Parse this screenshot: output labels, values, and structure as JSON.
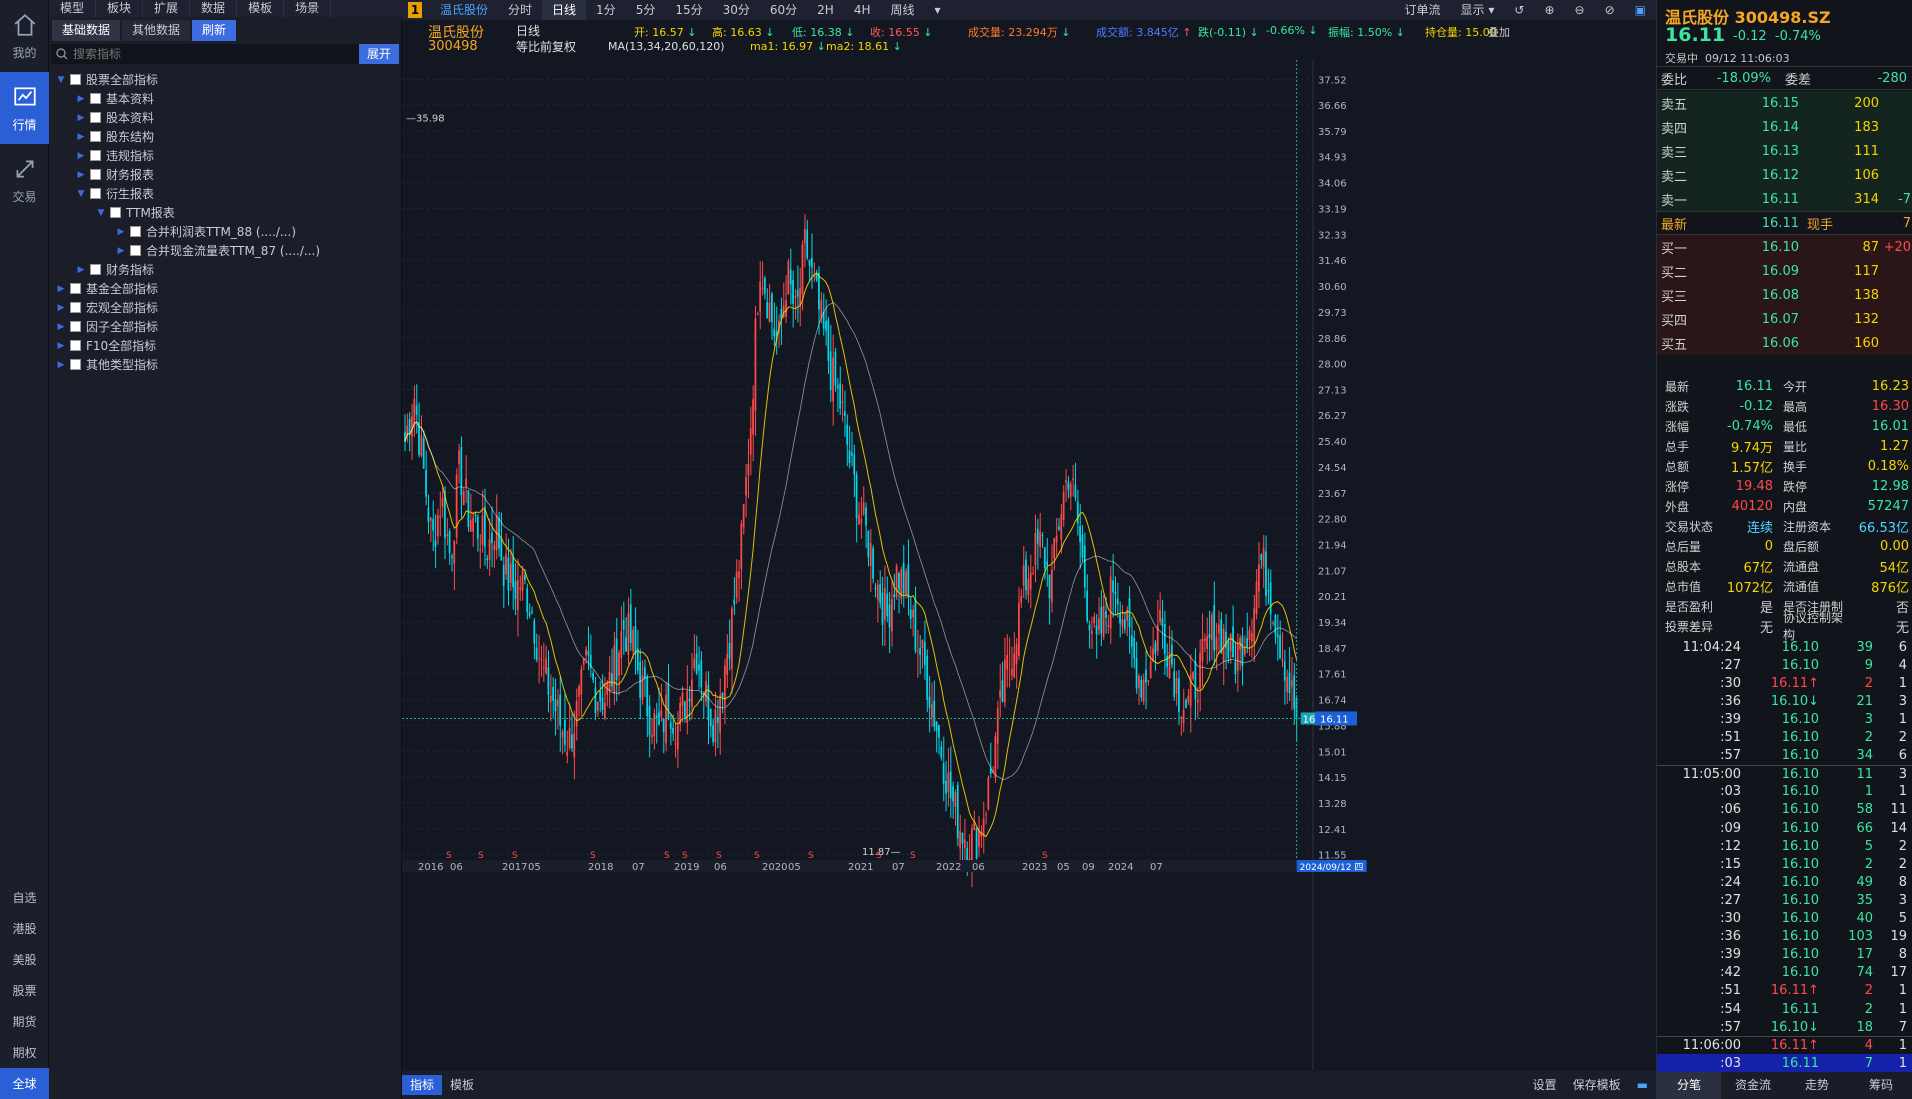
{
  "nav": {
    "items": [
      {
        "id": "home",
        "label": "我的"
      },
      {
        "id": "market",
        "label": "行情"
      },
      {
        "id": "trade",
        "label": "交易"
      }
    ],
    "markets": [
      "自选",
      "港股",
      "美股",
      "股票",
      "期货",
      "期权",
      "全球"
    ]
  },
  "menu": [
    "模型",
    "板块",
    "扩展",
    "数据",
    "模板",
    "场景"
  ],
  "panel": {
    "tabs": [
      "基础数据",
      "其他数据",
      "刷新"
    ],
    "search_placeholder": "搜索指标",
    "expand": "展开",
    "tree": [
      {
        "label": "股票全部指标",
        "lvl": 0,
        "open": true
      },
      {
        "label": "基本资料",
        "lvl": 1
      },
      {
        "label": "股本资料",
        "lvl": 1
      },
      {
        "label": "股东结构",
        "lvl": 1
      },
      {
        "label": "违规指标",
        "lvl": 1
      },
      {
        "label": "财务报表",
        "lvl": 1
      },
      {
        "label": "衍生报表",
        "lvl": 1,
        "open": true
      },
      {
        "label": "TTM报表",
        "lvl": 2,
        "open": true
      },
      {
        "label": "合并利润表TTM_88 (..../...)",
        "lvl": 3
      },
      {
        "label": "合并现金流量表TTM_87 (..../...)",
        "lvl": 3
      },
      {
        "label": "财务指标",
        "lvl": 1
      },
      {
        "label": "基金全部指标",
        "lvl": 0
      },
      {
        "label": "宏观全部指标",
        "lvl": 0
      },
      {
        "label": "因子全部指标",
        "lvl": 0
      },
      {
        "label": "F10全部指标",
        "lvl": 0
      },
      {
        "label": "其他类型指标",
        "lvl": 0
      }
    ]
  },
  "toolbar": {
    "badge": "1",
    "stock": "温氏股份",
    "periods": [
      "分时",
      "日线",
      "1分",
      "5分",
      "15分",
      "30分",
      "60分",
      "2H",
      "4H",
      "周线"
    ],
    "active": "日线",
    "right": [
      "订单流",
      "显示"
    ]
  },
  "info": {
    "name": "温氏股份",
    "code": "300498",
    "type": "日线",
    "fq": "等比前复权",
    "open_label": "开:",
    "open": "16.57",
    "high_label": "高:",
    "high": "16.63",
    "low_label": "低:",
    "low": "16.38",
    "close_label": "收:",
    "close": "16.55",
    "vol_label": "成交量:",
    "vol": "23.294万",
    "amt_label": "成交额:",
    "amt": "3.845亿",
    "fall": "跌(-0.11)",
    "fallpct": "-0.66%",
    "amp_label": "振幅:",
    "amp": "1.50%",
    "hold_label": "持仓量:",
    "hold": "15.00",
    "overlay": "叠加",
    "ma_text": "MA(13,34,20,60,120)",
    "ma1_label": "ma1:",
    "ma1": "16.97",
    "ma2_label": "ma2:",
    "ma2": "18.61"
  },
  "chart_data": {
    "type": "candlestick",
    "title": "温氏股份 300498 日线 等比前复权",
    "yticks": [
      37.52,
      36.66,
      35.79,
      34.93,
      34.06,
      33.19,
      32.33,
      31.46,
      30.6,
      29.73,
      28.86,
      28.0,
      27.13,
      26.27,
      25.4,
      24.54,
      23.67,
      22.8,
      21.94,
      21.07,
      20.21,
      19.34,
      18.47,
      17.61,
      16.74,
      15.88,
      15.01,
      14.15,
      13.28,
      12.41,
      11.55
    ],
    "ylim": [
      11.1,
      37.9
    ],
    "xlabels": [
      "2016",
      "06",
      "2017",
      "05",
      "2018",
      "07",
      "2019",
      "06",
      "2020",
      "05",
      "2021",
      "07",
      "2022",
      "06",
      "2023",
      "05",
      "09",
      "2024",
      "07"
    ],
    "cursor_date": "2024/09/12 四",
    "last_price": "16.11",
    "max_label": "35.98",
    "min_label": "11.87",
    "cursor_price": "16.11",
    "close_series": [
      25.4,
      27.0,
      24.5,
      22.0,
      23.5,
      21.5,
      24.5,
      23.0,
      22.5,
      21.8,
      22.6,
      21.0,
      20.5,
      20.7,
      19.7,
      17.8,
      17.0,
      16.0,
      15.3,
      16.4,
      18.0,
      17.0,
      16.8,
      17.8,
      19.2,
      18.6,
      17.2,
      16.2,
      15.6,
      16.7,
      15.8,
      17.0,
      18.4,
      17.0,
      16.0,
      17.6,
      19.5,
      22.0,
      26.0,
      31.5,
      30.0,
      28.5,
      31.0,
      29.5,
      32.0,
      30.5,
      29.0,
      27.5,
      26.5,
      24.5,
      23.0,
      22.0,
      20.5,
      19.5,
      21.0,
      20.5,
      19.0,
      18.0,
      16.5,
      15.0,
      13.5,
      12.5,
      12.0,
      12.2,
      13.5,
      15.5,
      17.5,
      18.8,
      20.5,
      21.5,
      22.0,
      20.5,
      23.0,
      24.5,
      22.5,
      20.0,
      18.5,
      19.5,
      20.8,
      19.5,
      18.2,
      17.3,
      18.0,
      19.5,
      18.4,
      17.0,
      16.5,
      17.4,
      18.3,
      19.2,
      18.9,
      18.0,
      18.6,
      19.5,
      21.5,
      20.5,
      19.0,
      17.6,
      16.11
    ]
  },
  "quote": {
    "name": "温氏股份",
    "code": "300498.SZ",
    "price": "16.11",
    "chg": "-0.12",
    "pct": "-0.74%",
    "status": "交易中",
    "time": "09/12  11:06:03",
    "webi_label": "委比",
    "webi": "-18.09%",
    "wecha_label": "委差",
    "wecha": "-280",
    "asks": [
      {
        "l": "卖五",
        "p": "16.15",
        "v": "200"
      },
      {
        "l": "卖四",
        "p": "16.14",
        "v": "183"
      },
      {
        "l": "卖三",
        "p": "16.13",
        "v": "111"
      },
      {
        "l": "卖二",
        "p": "16.12",
        "v": "106"
      },
      {
        "l": "卖一",
        "p": "16.11",
        "v": "314",
        "d": "-7"
      }
    ],
    "last_label": "最新",
    "last": "16.11",
    "now_label": "现手",
    "now": "7",
    "bids": [
      {
        "l": "买一",
        "p": "16.10",
        "v": "87",
        "d": "+20"
      },
      {
        "l": "买二",
        "p": "16.09",
        "v": "117"
      },
      {
        "l": "买三",
        "p": "16.08",
        "v": "138"
      },
      {
        "l": "买四",
        "p": "16.07",
        "v": "132"
      },
      {
        "l": "买五",
        "p": "16.06",
        "v": "160"
      }
    ],
    "stats": [
      [
        "最新",
        "16.11",
        "今开",
        "16.23"
      ],
      [
        "涨跌",
        "-0.12",
        "最高",
        "16.30"
      ],
      [
        "涨幅",
        "-0.74%",
        "最低",
        "16.01"
      ],
      [
        "总手",
        "9.74万",
        "量比",
        "1.27"
      ],
      [
        "总额",
        "1.57亿",
        "换手",
        "0.18%"
      ],
      [
        "涨停",
        "19.48",
        "跌停",
        "12.98"
      ],
      [
        "外盘",
        "40120",
        "内盘",
        "57247"
      ],
      [
        "交易状态",
        "连续",
        "注册资本",
        "66.53亿"
      ],
      [
        "总后量",
        "0",
        "盘后额",
        "0.00"
      ],
      [
        "总股本",
        "67亿",
        "流通盘",
        "54亿"
      ],
      [
        "总市值",
        "1072亿",
        "流通值",
        "876亿"
      ],
      [
        "是否盈利",
        "是",
        "是否注册制",
        "否"
      ],
      [
        "投票差异",
        "无",
        "协议控制架构",
        "无"
      ]
    ],
    "ticks": [
      [
        "11:04:24",
        "16.10",
        "39",
        "6"
      ],
      [
        ":27",
        "16.10",
        "9",
        "4"
      ],
      [
        ":30",
        "16.11↑",
        "2",
        "1"
      ],
      [
        ":36",
        "16.10↓",
        "21",
        "3"
      ],
      [
        ":39",
        "16.10",
        "3",
        "1"
      ],
      [
        ":51",
        "16.10",
        "2",
        "2"
      ],
      [
        ":57",
        "16.10",
        "34",
        "6"
      ],
      [
        "11:05:00",
        "16.10",
        "11",
        "3"
      ],
      [
        ":03",
        "16.10",
        "1",
        "1"
      ],
      [
        ":06",
        "16.10",
        "58",
        "11"
      ],
      [
        ":09",
        "16.10",
        "66",
        "14"
      ],
      [
        ":12",
        "16.10",
        "5",
        "2"
      ],
      [
        ":15",
        "16.10",
        "2",
        "2"
      ],
      [
        ":24",
        "16.10",
        "49",
        "8"
      ],
      [
        ":27",
        "16.10",
        "35",
        "3"
      ],
      [
        ":30",
        "16.10",
        "40",
        "5"
      ],
      [
        ":36",
        "16.10",
        "103",
        "19"
      ],
      [
        ":39",
        "16.10",
        "17",
        "8"
      ],
      [
        ":42",
        "16.10",
        "74",
        "17"
      ],
      [
        ":51",
        "16.11↑",
        "2",
        "1"
      ],
      [
        ":54",
        "16.11",
        "2",
        "1"
      ],
      [
        ":57",
        "16.10↓",
        "18",
        "7"
      ],
      [
        "11:06:00",
        "16.11↑",
        "4",
        "1"
      ],
      [
        ":03",
        "16.11",
        "7",
        "1"
      ]
    ],
    "tabs": [
      "分笔",
      "资金流",
      "走势",
      "筹码"
    ]
  },
  "bottom": {
    "tabs": [
      "指标",
      "模板"
    ],
    "right": [
      "设置",
      "保存模板"
    ]
  }
}
